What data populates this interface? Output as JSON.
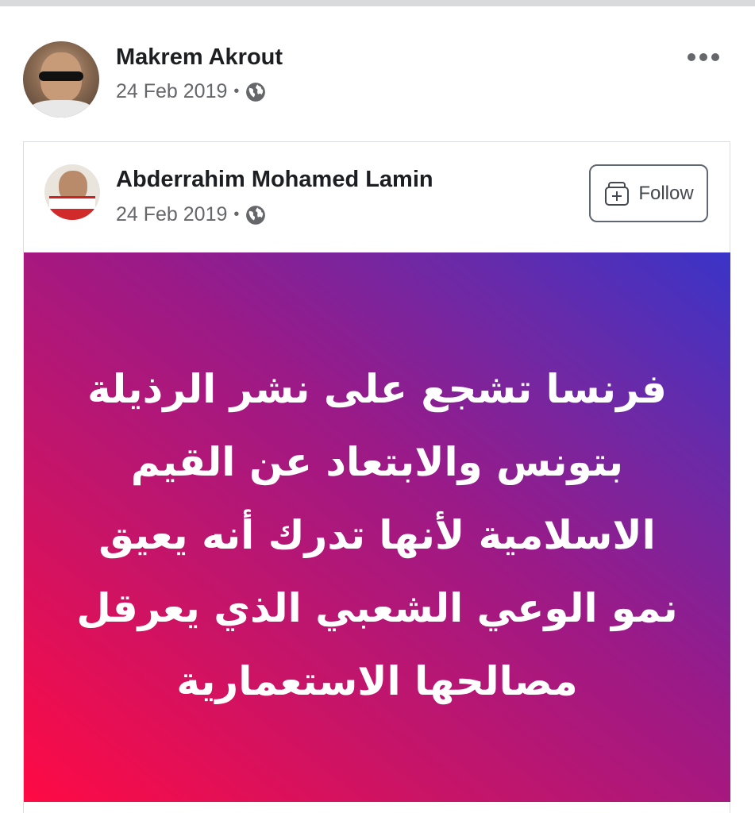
{
  "post": {
    "author": "Makrem Akrout",
    "date": "24 Feb 2019",
    "separator": "•",
    "privacy_icon": "globe-icon",
    "more_icon": "more-options-icon"
  },
  "shared_post": {
    "author": "Abderrahim Mohamed Lamin",
    "date": "24 Feb 2019",
    "separator": "•",
    "privacy_icon": "globe-icon",
    "follow_label": "Follow",
    "follow_icon": "follow-icon",
    "text_lines": [
      "فرنسا تشجع على نشر الرذيلة",
      "بتونس والابتعاد عن القيم",
      "الاسلامية لأنها تدرك أنه يعيق",
      "نمو الوعي الشعبي الذي يعرقل",
      "مصالحها الاستعمارية"
    ],
    "background_colors": [
      "#ff0a44",
      "#9a1a88",
      "#3a34c8"
    ],
    "text_color": "#ffffff"
  }
}
